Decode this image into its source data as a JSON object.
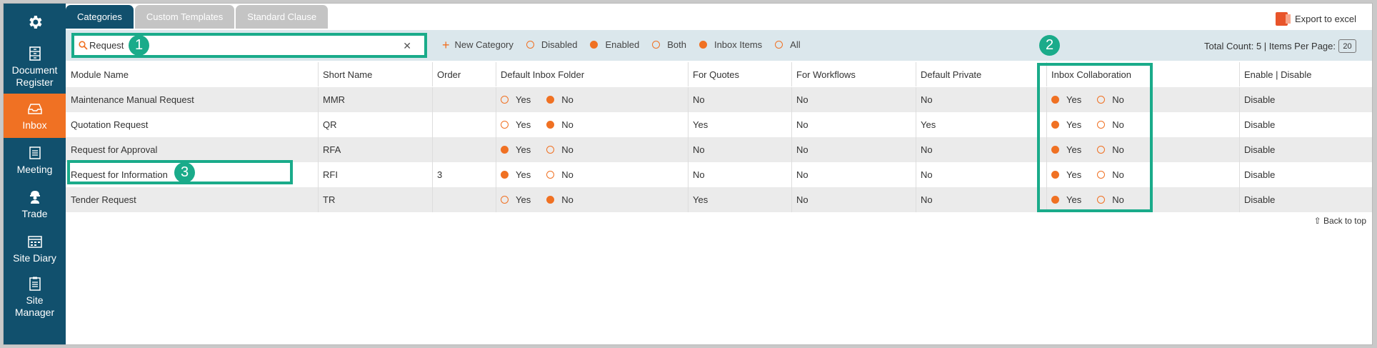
{
  "sidebar": {
    "items": [
      {
        "label": "Document Register",
        "icon": "document-register-icon",
        "active": false
      },
      {
        "label": "Inbox",
        "icon": "inbox-icon",
        "active": true
      },
      {
        "label": "Meeting",
        "icon": "meeting-icon",
        "active": false
      },
      {
        "label": "Trade",
        "icon": "trade-worker-icon",
        "active": false
      },
      {
        "label": "Site Diary",
        "icon": "calendar-icon",
        "active": false
      },
      {
        "label": "Site Manager",
        "icon": "site-manager-icon",
        "active": false
      }
    ]
  },
  "tabs": [
    {
      "label": "Categories",
      "active": true
    },
    {
      "label": "Custom Templates",
      "active": false
    },
    {
      "label": "Standard Clause",
      "active": false
    }
  ],
  "export_label": "Export to excel",
  "search": {
    "value": "Request"
  },
  "toolbar": {
    "new_category": "New Category",
    "filters": [
      {
        "label": "Disabled",
        "selected": false
      },
      {
        "label": "Enabled",
        "selected": true
      },
      {
        "label": "Both",
        "selected": false
      },
      {
        "label": "Inbox Items",
        "selected": true
      },
      {
        "label": "All",
        "selected": false
      }
    ],
    "total_count": "Total Count: 5 | Items Per Page:",
    "items_per_page": "20"
  },
  "table": {
    "headers": [
      "Module Name",
      "Short Name",
      "Order",
      "Default Inbox Folder",
      "For Quotes",
      "For Workflows",
      "Default Private",
      "Inbox Collaboration",
      "Enable | Disable"
    ],
    "yes_label": "Yes",
    "no_label": "No",
    "rows": [
      {
        "module": "Maintenance Manual Request",
        "short": "MMR",
        "order": "",
        "inbox_folder_yes": false,
        "quotes": "No",
        "workflows": "No",
        "private": "No",
        "collab_yes": true,
        "action": "Disable"
      },
      {
        "module": "Quotation Request",
        "short": "QR",
        "order": "",
        "inbox_folder_yes": false,
        "quotes": "Yes",
        "workflows": "No",
        "private": "Yes",
        "collab_yes": true,
        "action": "Disable"
      },
      {
        "module": "Request for Approval",
        "short": "RFA",
        "order": "",
        "inbox_folder_yes": true,
        "quotes": "No",
        "workflows": "No",
        "private": "No",
        "collab_yes": true,
        "action": "Disable"
      },
      {
        "module": "Request for Information",
        "short": "RFI",
        "order": "3",
        "inbox_folder_yes": true,
        "quotes": "No",
        "workflows": "No",
        "private": "No",
        "collab_yes": true,
        "action": "Disable"
      },
      {
        "module": "Tender Request",
        "short": "TR",
        "order": "",
        "inbox_folder_yes": false,
        "quotes": "Yes",
        "workflows": "No",
        "private": "No",
        "collab_yes": true,
        "action": "Disable"
      }
    ]
  },
  "back_to_top": "⇧ Back to top",
  "callouts": [
    "1",
    "2",
    "3"
  ],
  "colors": {
    "sidebar": "#11506d",
    "accent": "#f07123",
    "annotation": "#1aab8a"
  }
}
